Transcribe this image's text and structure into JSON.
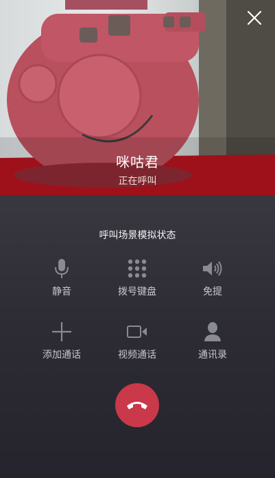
{
  "caller": {
    "name": "咪咕君",
    "status": "正在呼叫"
  },
  "scene_title": "呼叫场景模拟状态",
  "controls": {
    "mute": {
      "label": "静音",
      "icon": "microphone-icon"
    },
    "keypad": {
      "label": "拨号键盘",
      "icon": "keypad-icon"
    },
    "speaker": {
      "label": "免提",
      "icon": "speaker-icon"
    },
    "add_call": {
      "label": "添加通话",
      "icon": "plus-icon"
    },
    "video_call": {
      "label": "视频通话",
      "icon": "video-camera-icon"
    },
    "contacts": {
      "label": "通讯录",
      "icon": "person-icon"
    }
  },
  "end_call": {
    "icon": "hang-up-icon",
    "color": "#c9394a"
  },
  "close": {
    "icon": "close-icon"
  }
}
